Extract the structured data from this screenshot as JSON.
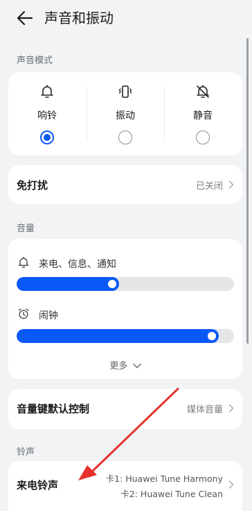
{
  "header": {
    "title": "声音和振动"
  },
  "sound_mode": {
    "section_label": "声音模式",
    "modes": [
      {
        "label": "响铃",
        "icon": "bell-icon",
        "selected": true
      },
      {
        "label": "振动",
        "icon": "vibrate-icon",
        "selected": false
      },
      {
        "label": "静音",
        "icon": "bell-off-icon",
        "selected": false
      }
    ]
  },
  "dnd": {
    "title": "免打扰",
    "value": "已关闭"
  },
  "volume": {
    "section_label": "音量",
    "items": [
      {
        "label": "来电、信息、通知",
        "icon": "bell-icon",
        "level": 0.47
      },
      {
        "label": "闹钟",
        "icon": "alarm-clock-icon",
        "level": 0.93
      }
    ],
    "more_label": "更多"
  },
  "volume_key": {
    "title": "音量键默认控制",
    "value": "媒体音量"
  },
  "ringtone": {
    "section_label": "铃声",
    "title": "来电铃声",
    "sim1": "卡1: Huawei Tune Harmony",
    "sim2": "卡2: Huawei Tune Clean"
  },
  "colors": {
    "accent": "#0a59f7",
    "annotation_arrow": "#e5322d",
    "background": "#f1f3f5"
  }
}
